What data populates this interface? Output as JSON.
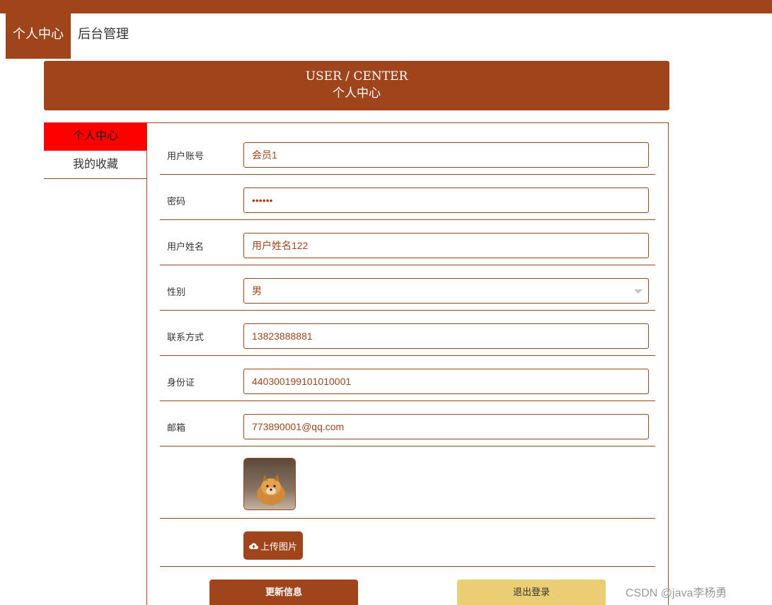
{
  "nav": {
    "items": [
      "个人中心",
      "后台管理"
    ]
  },
  "banner": {
    "en": "USER / CENTER",
    "cn": "个人中心"
  },
  "sidebar": {
    "items": [
      "个人中心",
      "我的收藏"
    ]
  },
  "form": {
    "fields": [
      {
        "label": "用户账号",
        "value": "会员1"
      },
      {
        "label": "密码",
        "value": "••••••"
      },
      {
        "label": "用户姓名",
        "value": "用户姓名122"
      },
      {
        "label": "性别",
        "value": "男"
      },
      {
        "label": "联系方式",
        "value": "13823888881"
      },
      {
        "label": "身份证",
        "value": "440300199101010001"
      },
      {
        "label": "邮箱",
        "value": "773890001@qq.com"
      }
    ],
    "upload_label": "上传图片",
    "update_label": "更新信息",
    "logout_label": "退出登录"
  },
  "watermark": "CSDN @java李杨勇",
  "colors": {
    "brand": "#a0441c",
    "active_sidebar": "#ff0000",
    "logout_button": "#ebcd73"
  }
}
